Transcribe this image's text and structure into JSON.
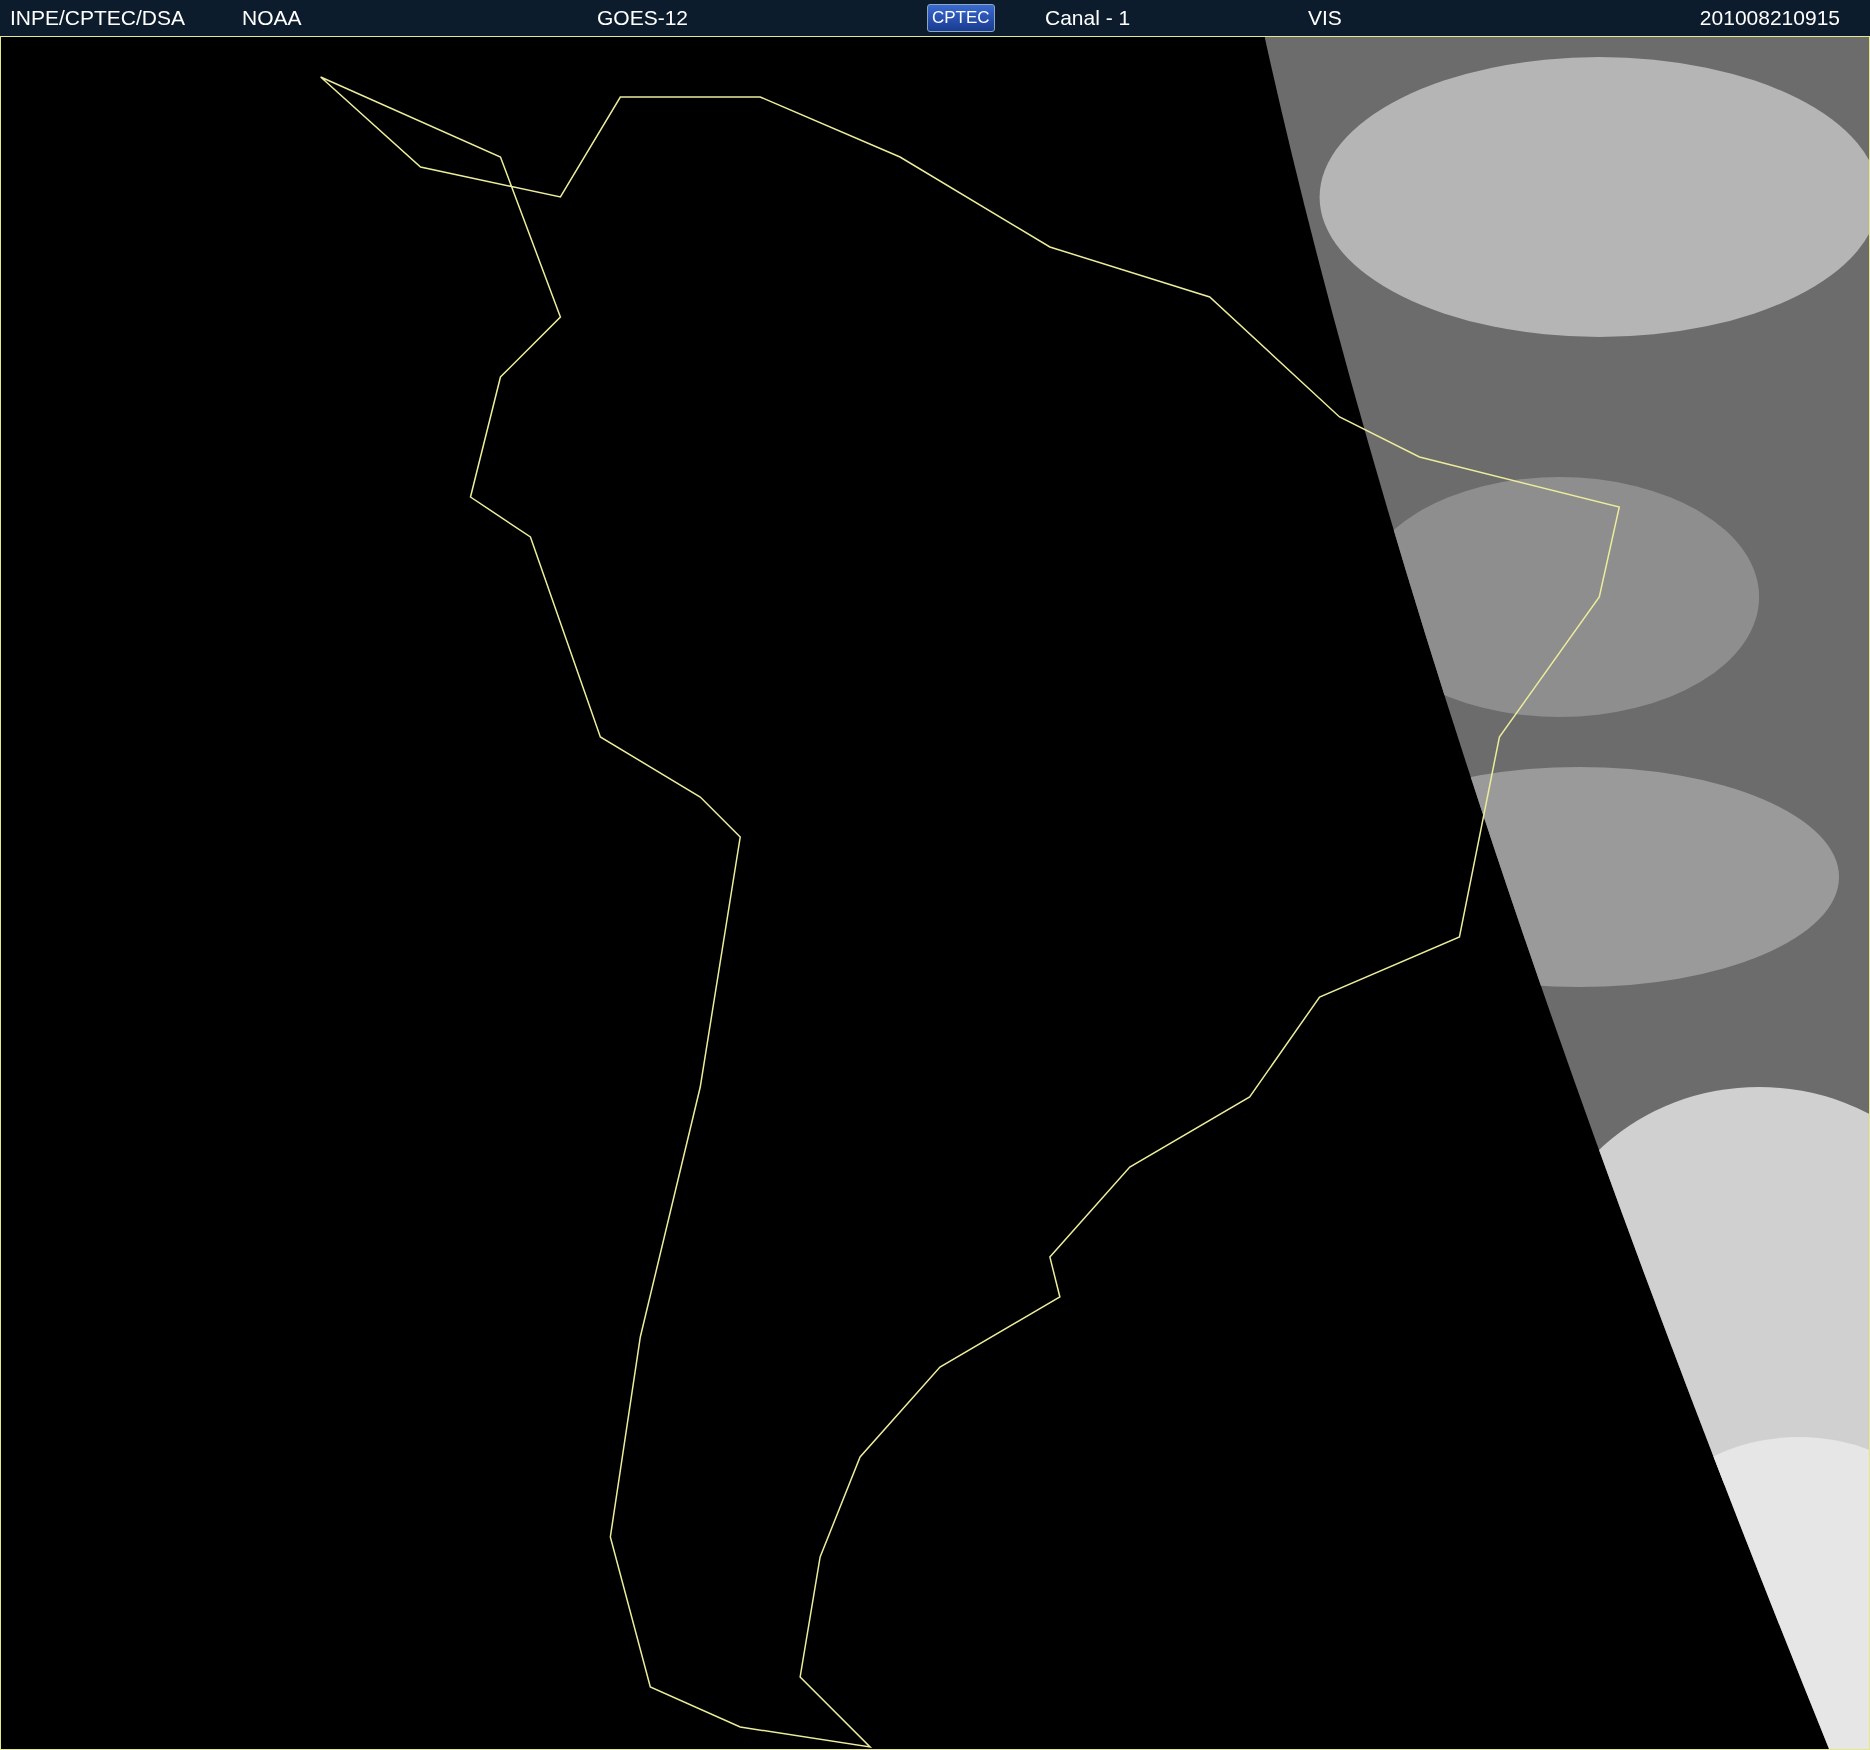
{
  "header": {
    "items": [
      {
        "kind": "text",
        "text": "INPE/CPTEC/DSA"
      },
      {
        "kind": "text",
        "text": "NOAA"
      },
      {
        "kind": "text",
        "text": "GOES-12"
      },
      {
        "kind": "logo",
        "text": "CPTEC"
      },
      {
        "kind": "text",
        "text": "Canal - 1"
      },
      {
        "kind": "text",
        "text": "VIS"
      },
      {
        "kind": "text",
        "text": "201008210915"
      }
    ]
  }
}
